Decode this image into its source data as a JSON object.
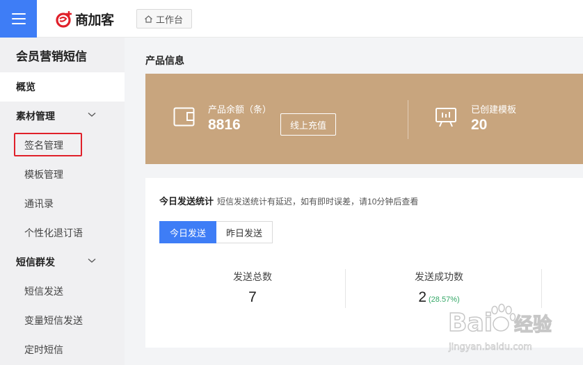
{
  "header": {
    "brand_name": "商加客",
    "breadcrumb": "工作台"
  },
  "sidebar": {
    "title": "会员营销短信",
    "items": [
      {
        "label": "概览"
      },
      {
        "label": "素材管理"
      },
      {
        "label": "签名管理"
      },
      {
        "label": "模板管理"
      },
      {
        "label": "通讯录"
      },
      {
        "label": "个性化退订语"
      },
      {
        "label": "短信群发"
      },
      {
        "label": "短信发送"
      },
      {
        "label": "变量短信发送"
      },
      {
        "label": "定时短信"
      }
    ]
  },
  "product": {
    "section_title": "产品信息",
    "balance_label": "产品余额（条）",
    "balance_value": "8816",
    "recharge_label": "线上充值",
    "templates_label": "已创建模板",
    "templates_value": "20"
  },
  "stats": {
    "title": "今日发送统计",
    "note": "短信发送统计有延迟，如有即时误差，请10分钟后查看",
    "tabs": [
      {
        "label": "今日发送"
      },
      {
        "label": "昨日发送"
      }
    ],
    "total_label": "发送总数",
    "total_value": "7",
    "success_label": "发送成功数",
    "success_value": "2",
    "success_pct": "(28.57%)"
  },
  "watermark": {
    "text1": "Bai",
    "text2": "经验",
    "url": "jingyan.baidu.com"
  },
  "colors": {
    "accent": "#3e7df6",
    "product_card": "#c8a57e",
    "highlight_box": "#e0202a",
    "success": "#33a766"
  }
}
